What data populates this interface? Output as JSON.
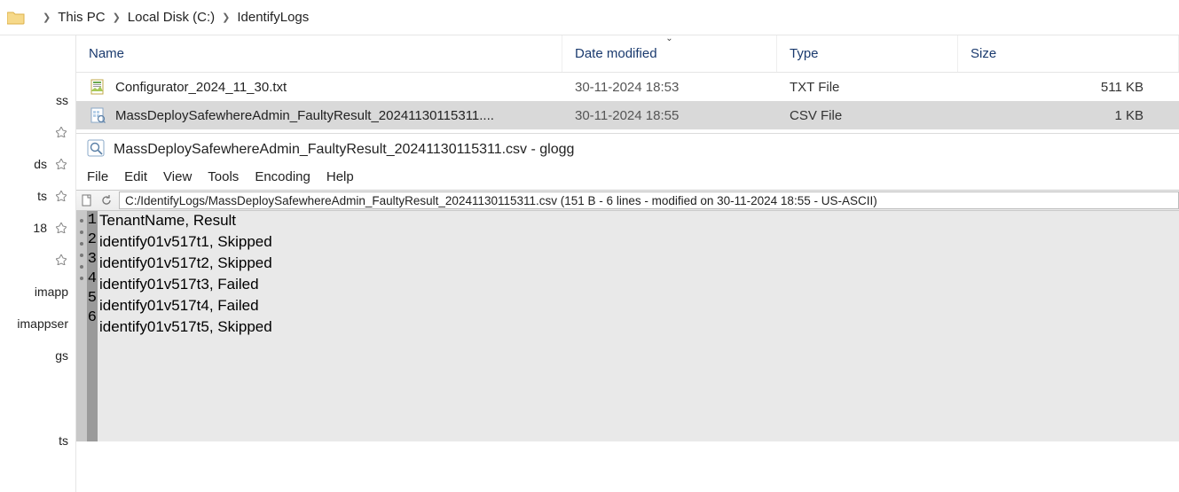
{
  "breadcrumb": {
    "p1": "This PC",
    "p2": "Local Disk (C:)",
    "p3": "IdentifyLogs"
  },
  "sidebar": {
    "items": [
      {
        "label": "ss"
      },
      {
        "label": "ds"
      },
      {
        "label": "ts"
      },
      {
        "label": "18"
      },
      {
        "label": ""
      },
      {
        "label": "imapp"
      },
      {
        "label": "imappser"
      },
      {
        "label": "gs"
      },
      {
        "label": ""
      },
      {
        "label": "ts"
      }
    ]
  },
  "columns": {
    "name": "Name",
    "date": "Date modified",
    "type": "Type",
    "size": "Size",
    "sort_arrow": "⌄"
  },
  "files": [
    {
      "name": "Configurator_2024_11_30.txt",
      "date": "30-11-2024 18:53",
      "type": "TXT File",
      "size": "511 KB",
      "icon": "txt"
    },
    {
      "name": "MassDeploySafewhereAdmin_FaultyResult_20241130115311....",
      "date": "30-11-2024 18:55",
      "type": "CSV File",
      "size": "1 KB",
      "icon": "csv",
      "selected": true
    }
  ],
  "glogg": {
    "title": "MassDeploySafewhereAdmin_FaultyResult_20241130115311.csv - glogg",
    "menu": {
      "file": "File",
      "edit": "Edit",
      "view": "View",
      "tools": "Tools",
      "encoding": "Encoding",
      "help": "Help"
    },
    "path": "C:/IdentifyLogs/MassDeploySafewhereAdmin_FaultyResult_20241130115311.csv (151 B - 6 lines - modified on 30-11-2024 18:55 - US-ASCII)",
    "lines": [
      "TenantName, Result",
      "identify01v517t1, Skipped",
      "identify01v517t2, Skipped",
      "identify01v517t3, Failed",
      "identify01v517t4, Failed",
      "identify01v517t5, Skipped"
    ]
  }
}
